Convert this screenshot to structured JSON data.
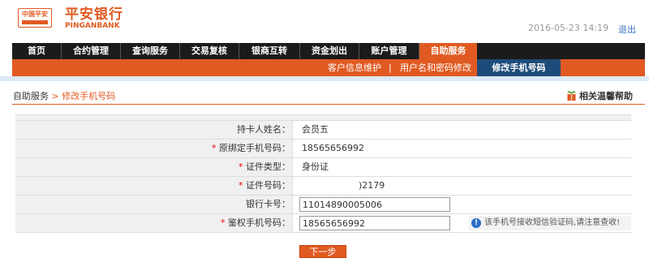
{
  "header": {
    "logo_mark_text": "中国平安",
    "bank_name_cn": "平安银行",
    "bank_name_en": "PINGANBANK",
    "datetime": "2016-05-23  14:19",
    "logout": "退出"
  },
  "nav": {
    "items": [
      {
        "label": "首页"
      },
      {
        "label": "合约管理"
      },
      {
        "label": "查询服务"
      },
      {
        "label": "交易复核"
      },
      {
        "label": "银商互转"
      },
      {
        "label": "资金划出"
      },
      {
        "label": "账户管理"
      },
      {
        "label": "自助服务",
        "active": true
      }
    ]
  },
  "subnav": {
    "items": [
      {
        "label": "客户信息维护"
      },
      {
        "label": "用户名和密码修改"
      },
      {
        "label": "修改手机号码",
        "active": true
      }
    ],
    "separator": "|"
  },
  "breadcrumb": {
    "parent": "自助服务",
    "arrow": ">",
    "current": "修改手机号码"
  },
  "help": {
    "label": "相关温馨帮助"
  },
  "form": {
    "rows": [
      {
        "label": "持卡人姓名：",
        "required": false,
        "value": "会员五"
      },
      {
        "label": "原绑定手机号码：",
        "required": true,
        "value": "18565656992"
      },
      {
        "label": "证件类型：",
        "required": true,
        "value": "身份证"
      },
      {
        "label": "证件号码：",
        "required": true,
        "value": ")2179"
      },
      {
        "label": "银行卡号：",
        "required": false,
        "input_value": "11014890005006"
      },
      {
        "label": "鉴权手机号码：",
        "required": true,
        "input_value": "18565656992",
        "tip": "该手机号接收短信验证码,请注意查收!"
      }
    ],
    "required_mark": "*"
  },
  "buttons": {
    "next": "下一步"
  },
  "colors": {
    "brand": "#e05a22",
    "nav_bg": "#1b1b1b",
    "subnav_active": "#1e4c7a"
  }
}
